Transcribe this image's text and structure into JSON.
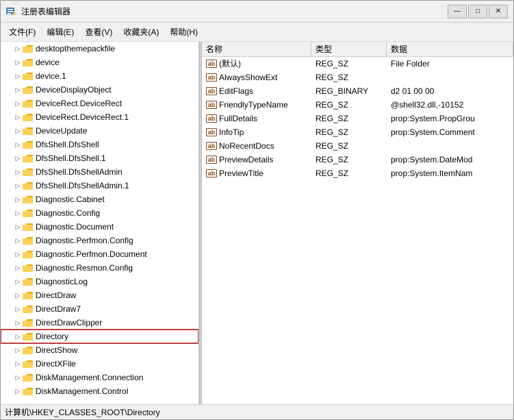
{
  "window": {
    "title": "注册表编辑器",
    "icon": "regedit-icon"
  },
  "menu": {
    "items": [
      "文件(F)",
      "编辑(E)",
      "查看(V)",
      "收藏夹(A)",
      "帮助(H)"
    ]
  },
  "tree": {
    "items": [
      {
        "label": "desktopthemepackfile",
        "indent": 1,
        "expanded": false,
        "selected": false
      },
      {
        "label": "device",
        "indent": 1,
        "expanded": false,
        "selected": false
      },
      {
        "label": "device.1",
        "indent": 1,
        "expanded": false,
        "selected": false
      },
      {
        "label": "DeviceDisplayObject",
        "indent": 1,
        "expanded": false,
        "selected": false
      },
      {
        "label": "DeviceRect.DeviceRect",
        "indent": 1,
        "expanded": false,
        "selected": false
      },
      {
        "label": "DeviceRect.DeviceRect.1",
        "indent": 1,
        "expanded": false,
        "selected": false
      },
      {
        "label": "DeviceUpdate",
        "indent": 1,
        "expanded": false,
        "selected": false
      },
      {
        "label": "DfsShell.DfsShell",
        "indent": 1,
        "expanded": false,
        "selected": false
      },
      {
        "label": "DfsShell.DfsShell.1",
        "indent": 1,
        "expanded": false,
        "selected": false
      },
      {
        "label": "DfsShell.DfsShellAdmin",
        "indent": 1,
        "expanded": false,
        "selected": false
      },
      {
        "label": "DfsShell.DfsShellAdmin.1",
        "indent": 1,
        "expanded": false,
        "selected": false
      },
      {
        "label": "Diagnostic.Cabinet",
        "indent": 1,
        "expanded": false,
        "selected": false
      },
      {
        "label": "Diagnostic.Config",
        "indent": 1,
        "expanded": false,
        "selected": false
      },
      {
        "label": "Diagnostic.Document",
        "indent": 1,
        "expanded": false,
        "selected": false
      },
      {
        "label": "Diagnostic.Perfmon.Config",
        "indent": 1,
        "expanded": false,
        "selected": false
      },
      {
        "label": "Diagnostic.Perfmon.Document",
        "indent": 1,
        "expanded": false,
        "selected": false
      },
      {
        "label": "Diagnostic.Resmon.Config",
        "indent": 1,
        "expanded": false,
        "selected": false
      },
      {
        "label": "DiagnosticLog",
        "indent": 1,
        "expanded": false,
        "selected": false
      },
      {
        "label": "DirectDraw",
        "indent": 1,
        "expanded": false,
        "selected": false
      },
      {
        "label": "DirectDraw7",
        "indent": 1,
        "expanded": false,
        "selected": false
      },
      {
        "label": "DirectDrawClipper",
        "indent": 1,
        "expanded": false,
        "selected": false
      },
      {
        "label": "Directory",
        "indent": 1,
        "expanded": false,
        "selected": true
      },
      {
        "label": "DirectShow",
        "indent": 1,
        "expanded": false,
        "selected": false
      },
      {
        "label": "DirectXFile",
        "indent": 1,
        "expanded": false,
        "selected": false
      },
      {
        "label": "DiskManagement.Connection",
        "indent": 1,
        "expanded": false,
        "selected": false
      },
      {
        "label": "DiskManagement.Control",
        "indent": 1,
        "expanded": false,
        "selected": false
      }
    ]
  },
  "detail": {
    "columns": [
      "名称",
      "类型",
      "数据"
    ],
    "rows": [
      {
        "name": "(默认)",
        "type": "REG_SZ",
        "data": "File Folder",
        "icon": "ab"
      },
      {
        "name": "AlwaysShowExt",
        "type": "REG_SZ",
        "data": "",
        "icon": "ab"
      },
      {
        "name": "EditFlags",
        "type": "REG_BINARY",
        "data": "d2 01 00 00",
        "icon": "ab"
      },
      {
        "name": "FriendlyTypeName",
        "type": "REG_SZ",
        "data": "@shell32.dll,-10152",
        "icon": "ab"
      },
      {
        "name": "FullDetails",
        "type": "REG_SZ",
        "data": "prop:System.PropGrou",
        "icon": "ab"
      },
      {
        "name": "InfoTip",
        "type": "REG_SZ",
        "data": "prop:System.Comment",
        "icon": "ab"
      },
      {
        "name": "NoRecentDocs",
        "type": "REG_SZ",
        "data": "",
        "icon": "ab"
      },
      {
        "name": "PreviewDetails",
        "type": "REG_SZ",
        "data": "prop:System.DateMod",
        "icon": "ab"
      },
      {
        "name": "PreviewTitle",
        "type": "REG_SZ",
        "data": "prop:System.ItemNam",
        "icon": "ab"
      }
    ]
  },
  "statusbar": {
    "text": "计算机\\HKEY_CLASSES_ROOT\\Directory"
  },
  "buttons": {
    "minimize": "—",
    "maximize": "□",
    "close": "✕"
  }
}
